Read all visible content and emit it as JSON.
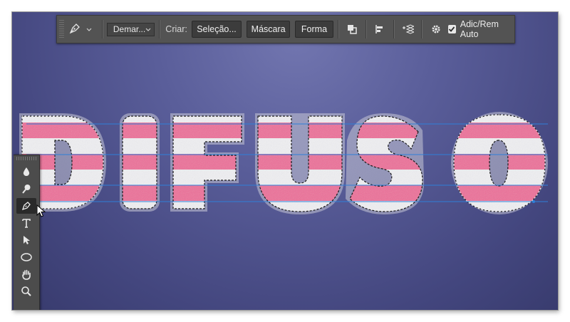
{
  "canvas": {
    "artwork_text": "DIFUSO",
    "colors": {
      "background": "#4f5390",
      "stripe_pink": "#ec6f9a",
      "letter_white": "#efeff2",
      "guide_blue": "#2f7fd8"
    }
  },
  "options_bar": {
    "tool_icon": "pen-icon",
    "mode_dropdown": "Demar...",
    "create_label": "Criar:",
    "buttons": {
      "selection": "Seleção...",
      "mask": "Máscara",
      "shape": "Forma"
    },
    "icons": [
      "path-operations-icon",
      "path-alignment-icon",
      "path-arrangement-icon",
      "gear-icon"
    ],
    "auto_add_delete": {
      "label": "Adic/Rem Auto",
      "checked": true
    }
  },
  "toolbar": {
    "tools": [
      "blur-icon",
      "dodge-icon",
      "pen-icon",
      "type-icon",
      "path-selection-icon",
      "ellipse-icon",
      "hand-icon",
      "zoom-icon"
    ],
    "active_tool": "pen-icon"
  }
}
